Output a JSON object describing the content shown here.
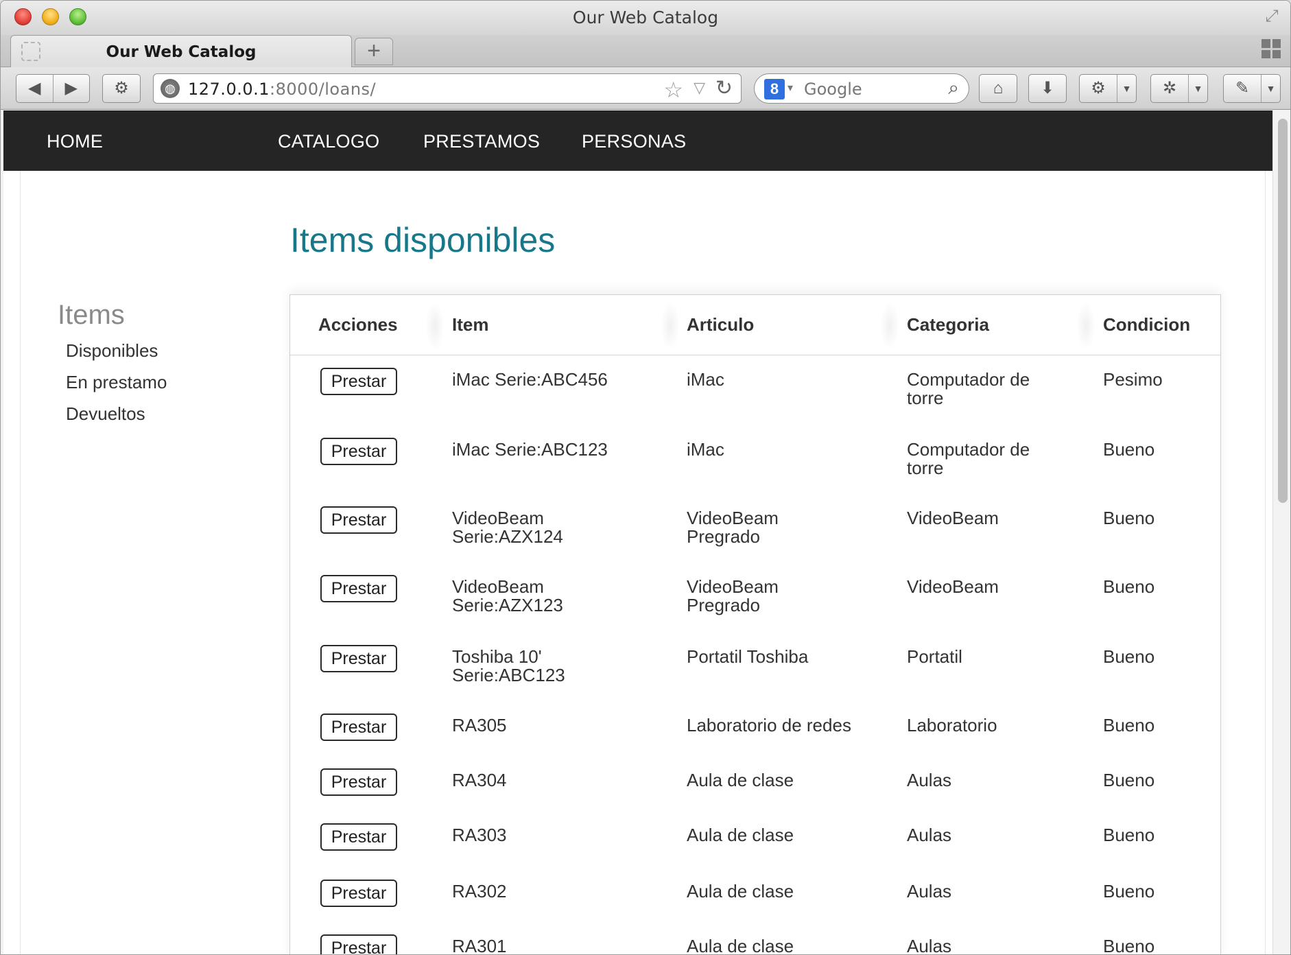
{
  "browser": {
    "window_title": "Our Web Catalog",
    "tab_title": "Our Web Catalog",
    "new_tab_label": "+",
    "url_host": "127.0.0.1",
    "url_rest": ":8000/loans/",
    "search_engine_letter": "8",
    "search_placeholder": "Google"
  },
  "nav": {
    "home": "HOME",
    "catalogo": "CATALOGO",
    "prestamos": "PRESTAMOS",
    "personas": "PERSONAS"
  },
  "sidebar": {
    "heading": "Items",
    "links": [
      "Disponibles",
      "En prestamo",
      "Devueltos"
    ]
  },
  "main": {
    "title": "Items disponibles",
    "columns": [
      "Acciones",
      "Item",
      "Articulo",
      "Categoria",
      "Condicion"
    ],
    "action_label": "Prestar",
    "rows": [
      {
        "item": [
          "iMac Serie:ABC456"
        ],
        "articulo": [
          "iMac"
        ],
        "categoria": [
          "Computador de",
          "torre"
        ],
        "condicion": "Pesimo"
      },
      {
        "item": [
          "iMac Serie:ABC123"
        ],
        "articulo": [
          "iMac"
        ],
        "categoria": [
          "Computador de",
          "torre"
        ],
        "condicion": "Bueno"
      },
      {
        "item": [
          "VideoBeam",
          "Serie:AZX124"
        ],
        "articulo": [
          "VideoBeam",
          "Pregrado"
        ],
        "categoria": [
          "VideoBeam"
        ],
        "condicion": "Bueno"
      },
      {
        "item": [
          "VideoBeam",
          "Serie:AZX123"
        ],
        "articulo": [
          "VideoBeam",
          "Pregrado"
        ],
        "categoria": [
          "VideoBeam"
        ],
        "condicion": "Bueno"
      },
      {
        "item": [
          "Toshiba 10'",
          "Serie:ABC123"
        ],
        "articulo": [
          "Portatil Toshiba"
        ],
        "categoria": [
          "Portatil"
        ],
        "condicion": "Bueno"
      },
      {
        "item": [
          "RA305"
        ],
        "articulo": [
          "Laboratorio de redes"
        ],
        "categoria": [
          "Laboratorio"
        ],
        "condicion": "Bueno"
      },
      {
        "item": [
          "RA304"
        ],
        "articulo": [
          "Aula de clase"
        ],
        "categoria": [
          "Aulas"
        ],
        "condicion": "Bueno"
      },
      {
        "item": [
          "RA303"
        ],
        "articulo": [
          "Aula de clase"
        ],
        "categoria": [
          "Aulas"
        ],
        "condicion": "Bueno"
      },
      {
        "item": [
          "RA302"
        ],
        "articulo": [
          "Aula de clase"
        ],
        "categoria": [
          "Aulas"
        ],
        "condicion": "Bueno"
      },
      {
        "item": [
          "RA301"
        ],
        "articulo": [
          "Aula de clase"
        ],
        "categoria": [
          "Aulas"
        ],
        "condicion": "Bueno"
      }
    ]
  },
  "colors": {
    "navbar": "#252525",
    "title_accent": "#17788a"
  }
}
